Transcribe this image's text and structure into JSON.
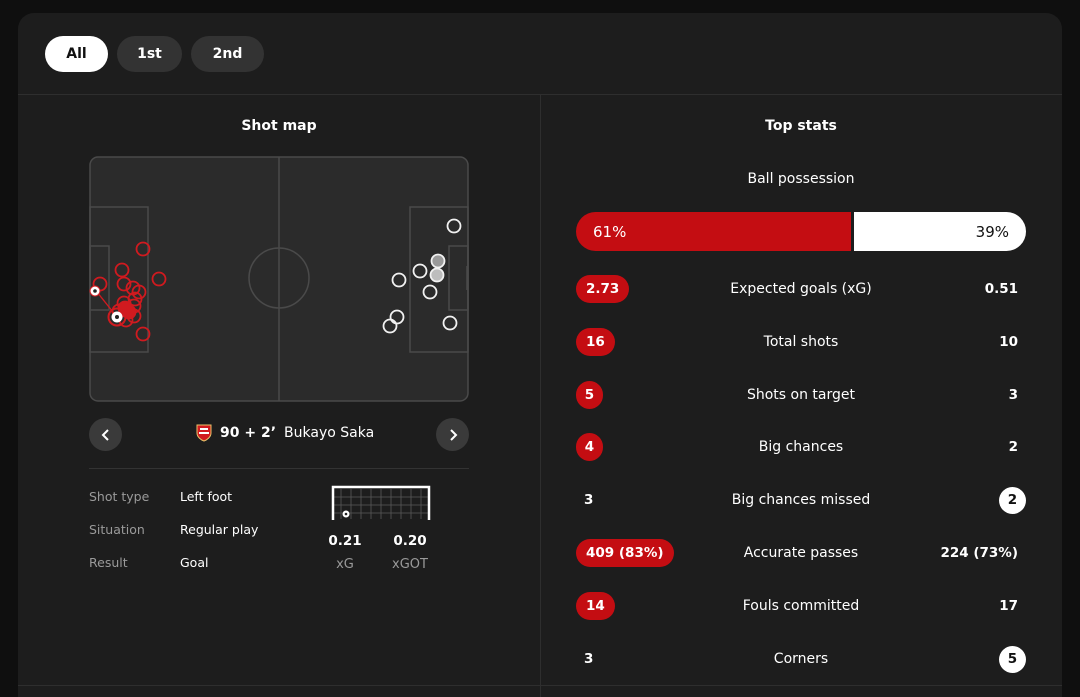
{
  "tabs": [
    {
      "label": "All",
      "active": true
    },
    {
      "label": "1st",
      "active": false
    },
    {
      "label": "2nd",
      "active": false
    }
  ],
  "shot_map": {
    "title": "Shot map",
    "selected_shot": {
      "minute": "90 + 2’",
      "player": "Bukayo Saka",
      "team_icon": "arsenal-crest-icon"
    },
    "details": [
      {
        "key": "Shot type",
        "value": "Left foot"
      },
      {
        "key": "Situation",
        "value": "Regular play"
      },
      {
        "key": "Result",
        "value": "Goal"
      }
    ],
    "xg": {
      "value": "0.21",
      "label": "xG"
    },
    "xgot": {
      "value": "0.20",
      "label": "xGOT"
    }
  },
  "top_stats": {
    "title": "Top stats",
    "possession": {
      "label": "Ball possession",
      "home": "61%",
      "away": "39%",
      "home_fraction": 0.61
    },
    "rows": [
      {
        "label": "Expected goals (xG)",
        "home": "2.73",
        "away": "0.51",
        "highlight": "home"
      },
      {
        "label": "Total shots",
        "home": "16",
        "away": "10",
        "highlight": "home"
      },
      {
        "label": "Shots on target",
        "home": "5",
        "away": "3",
        "highlight": "home"
      },
      {
        "label": "Big chances",
        "home": "4",
        "away": "2",
        "highlight": "home"
      },
      {
        "label": "Big chances missed",
        "home": "3",
        "away": "2",
        "highlight": "away"
      },
      {
        "label": "Accurate passes",
        "home": "409 (83%)",
        "away": "224 (73%)",
        "highlight": "home"
      },
      {
        "label": "Fouls committed",
        "home": "14",
        "away": "17",
        "highlight": "home"
      },
      {
        "label": "Corners",
        "home": "3",
        "away": "5",
        "highlight": "away"
      }
    ]
  },
  "colors": {
    "home": "#c40d12",
    "away": "#ffffff",
    "panel": "#1d1d1d"
  }
}
